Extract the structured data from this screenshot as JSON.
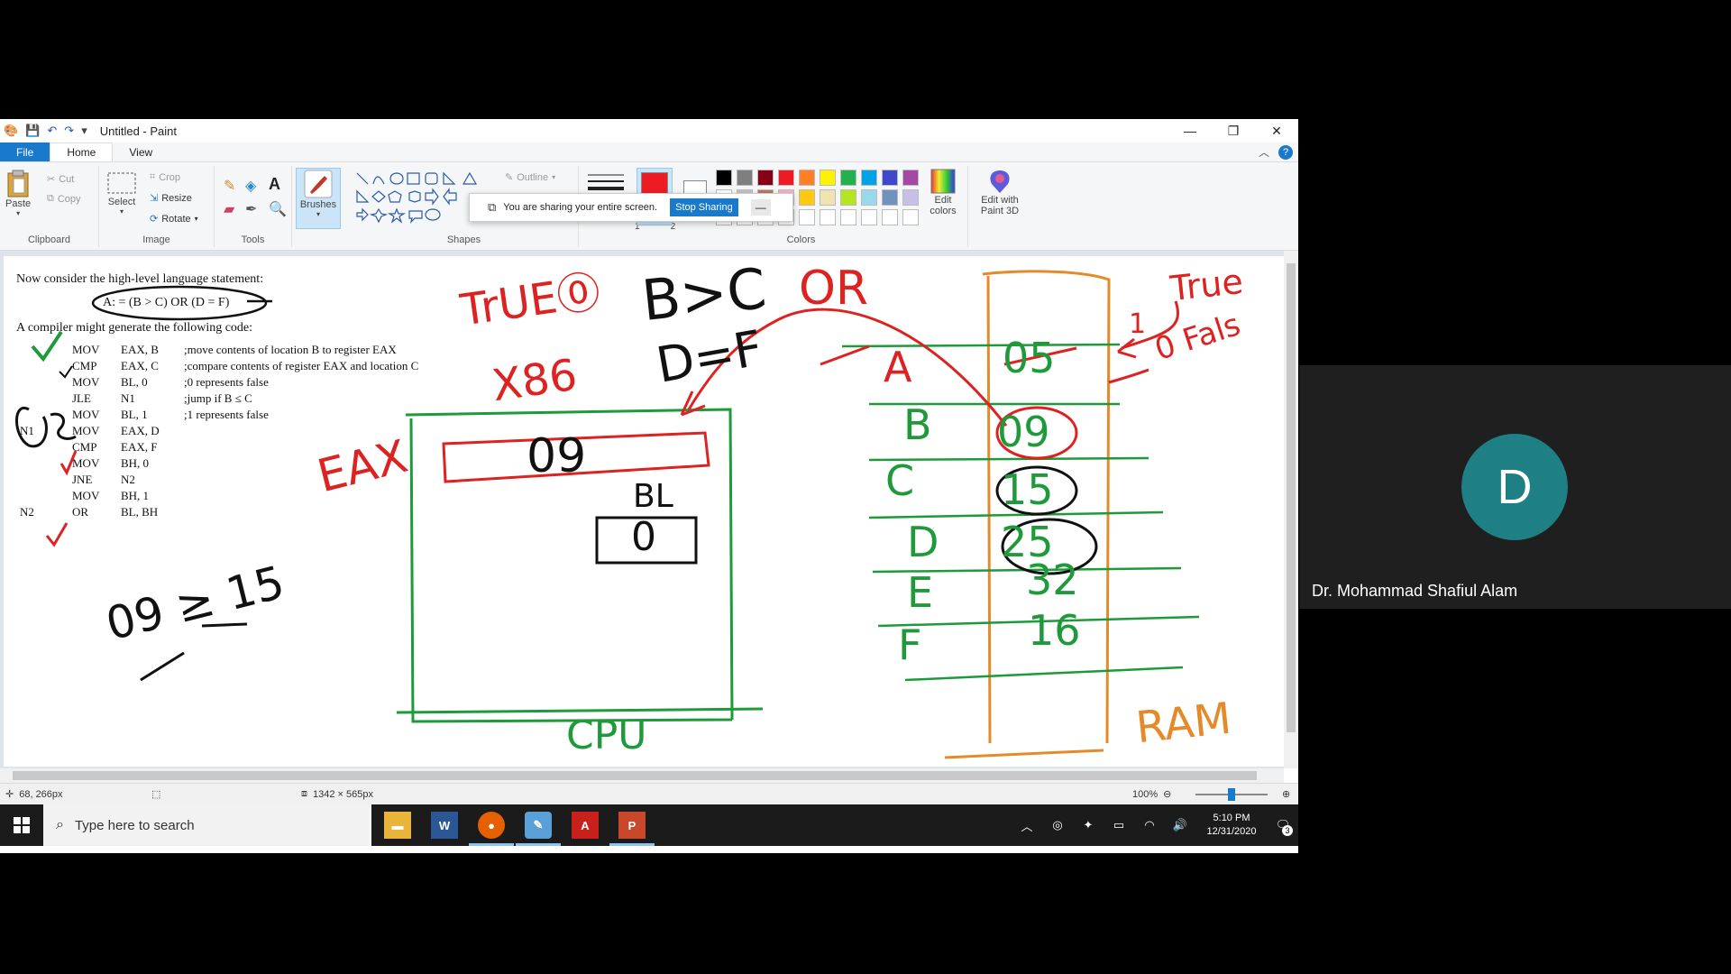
{
  "window": {
    "title": "Untitled - Paint",
    "controls": [
      "—",
      "❐",
      "✕"
    ]
  },
  "tabs": [
    {
      "label": "File"
    },
    {
      "label": "Home"
    },
    {
      "label": "View"
    }
  ],
  "ribbon": {
    "clipboard": {
      "paste": "Paste",
      "cut": "Cut",
      "copy": "Copy",
      "group": "Clipboard"
    },
    "image": {
      "select": "Select",
      "crop": "Crop",
      "resize": "Resize",
      "rotate": "Rotate",
      "group": "Image"
    },
    "tools": {
      "group": "Tools"
    },
    "brushes": {
      "label": "Brushes"
    },
    "shapes": {
      "outline": "Outline",
      "group": "Shapes"
    },
    "size": {
      "labels": [
        "1",
        "2"
      ]
    },
    "colors": {
      "group": "Colors",
      "edit": "Edit colors",
      "paint3d": "Edit with Paint 3D",
      "palette": [
        "#000000",
        "#7f7f7f",
        "#880015",
        "#ed1c24",
        "#ff7f27",
        "#fff200",
        "#22b14c",
        "#00a2e8",
        "#3f48cc",
        "#a349a4"
      ],
      "palette2": [
        "#ffffff",
        "#c3c3c3",
        "#b97a57",
        "#ffaec9",
        "#ffc90e",
        "#efe4b0",
        "#b5e61d",
        "#99d9ea",
        "#7092be",
        "#c8bfe7"
      ],
      "color1": "#ed1c24",
      "color2": "#ffffff"
    }
  },
  "share_bar": {
    "text": "You are sharing your entire screen.",
    "button": "Stop Sharing",
    "minimize": "—"
  },
  "document": {
    "line1": "Now consider the high-level language statement:",
    "statement": "A: = (B > C) OR (D = F)",
    "line2": "A compiler might generate the following code:",
    "code": [
      {
        "label": "",
        "op": "MOV",
        "args": "EAX, B",
        "comment": ";move contents of location B to register EAX"
      },
      {
        "label": "",
        "op": "CMP",
        "args": "EAX, C",
        "comment": ";compare contents of register EAX and location C"
      },
      {
        "label": "",
        "op": "MOV",
        "args": "BL, 0",
        "comment": ";0 represents false"
      },
      {
        "label": "",
        "op": "JLE",
        "args": "N1",
        "comment": ";jump if B ≤ C"
      },
      {
        "label": "",
        "op": "MOV",
        "args": "BL, 1",
        "comment": ";1 represents false"
      },
      {
        "label": "N1",
        "op": "MOV",
        "args": "EAX, D",
        "comment": ""
      },
      {
        "label": "",
        "op": "CMP",
        "args": "EAX, F",
        "comment": ""
      },
      {
        "label": "",
        "op": "MOV",
        "args": "BH, 0",
        "comment": ""
      },
      {
        "label": "",
        "op": "JNE",
        "args": "N2",
        "comment": ""
      },
      {
        "label": "",
        "op": "MOV",
        "args": "BH, 1",
        "comment": ""
      },
      {
        "label": "N2",
        "op": "OR",
        "args": "BL, BH",
        "comment": ""
      }
    ]
  },
  "annotations": {
    "true0": "TrUE⓪",
    "bgc": "B>C",
    "or": "OR",
    "dfe": "D=F",
    "x86": "X86",
    "eax": "EAX",
    "eax_val": "09",
    "bl": "BL",
    "bl_val": "0",
    "cpu": "CPU",
    "ram": "RAM",
    "true": "True",
    "one": "1",
    "zero_false": "0 Fals",
    "mem_labels": [
      "A",
      "B",
      "C",
      "D",
      "E",
      "F"
    ],
    "mem_values": [
      "05",
      "09",
      "15",
      "25",
      "32",
      "16"
    ],
    "scratch": "09 ≥ 15"
  },
  "status": {
    "cursor": "68, 266px",
    "size": "1342 × 565px",
    "zoom": "100%"
  },
  "taskbar": {
    "search_placeholder": "Type here to search",
    "time": "5:10 PM",
    "date": "12/31/2020",
    "notifications": "3"
  },
  "participant": {
    "initial": "D",
    "name": "Dr. Mohammad Shafiul Alam",
    "avatar_color": "#1e7f85"
  }
}
